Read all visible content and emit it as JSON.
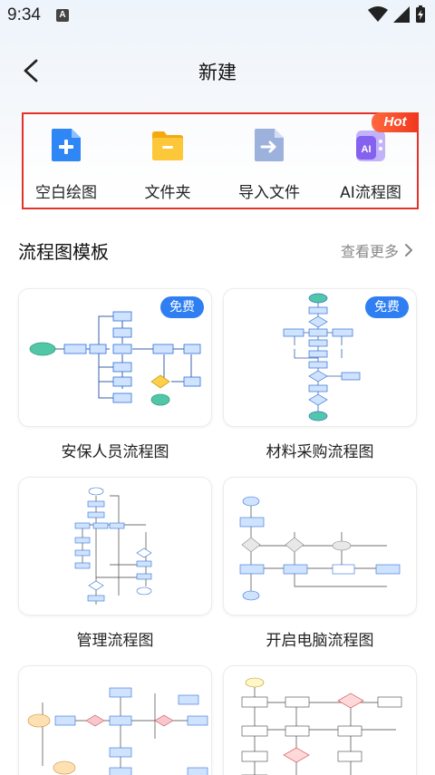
{
  "status": {
    "time": "9:34",
    "notif_icon": "a-notification-icon"
  },
  "header": {
    "title": "新建",
    "back_icon": "back-arrow-icon"
  },
  "quick_actions": [
    {
      "label": "空白绘图",
      "icon": "blank-add-icon",
      "color": "#2f86f5"
    },
    {
      "label": "文件夹",
      "icon": "folder-icon",
      "color": "#f8bd1c"
    },
    {
      "label": "导入文件",
      "icon": "import-file-icon",
      "color": "#8fa6d6"
    },
    {
      "label": "AI流程图",
      "icon": "ai-flow-icon",
      "color": "#8b6cf0",
      "badge": "Hot"
    }
  ],
  "templates_section": {
    "title": "流程图模板",
    "more": "查看更多"
  },
  "templates": [
    {
      "name": "安保人员流程图",
      "badge": "免费"
    },
    {
      "name": "材料采购流程图",
      "badge": "免费"
    },
    {
      "name": "管理流程图",
      "badge": ""
    },
    {
      "name": "开启电脑流程图",
      "badge": ""
    },
    {
      "name": "",
      "badge": ""
    },
    {
      "name": "",
      "badge": ""
    }
  ],
  "colors": {
    "highlight_border": "#e4322b",
    "badge_blue": "#2f7ff2",
    "hot": "#f0361f"
  }
}
